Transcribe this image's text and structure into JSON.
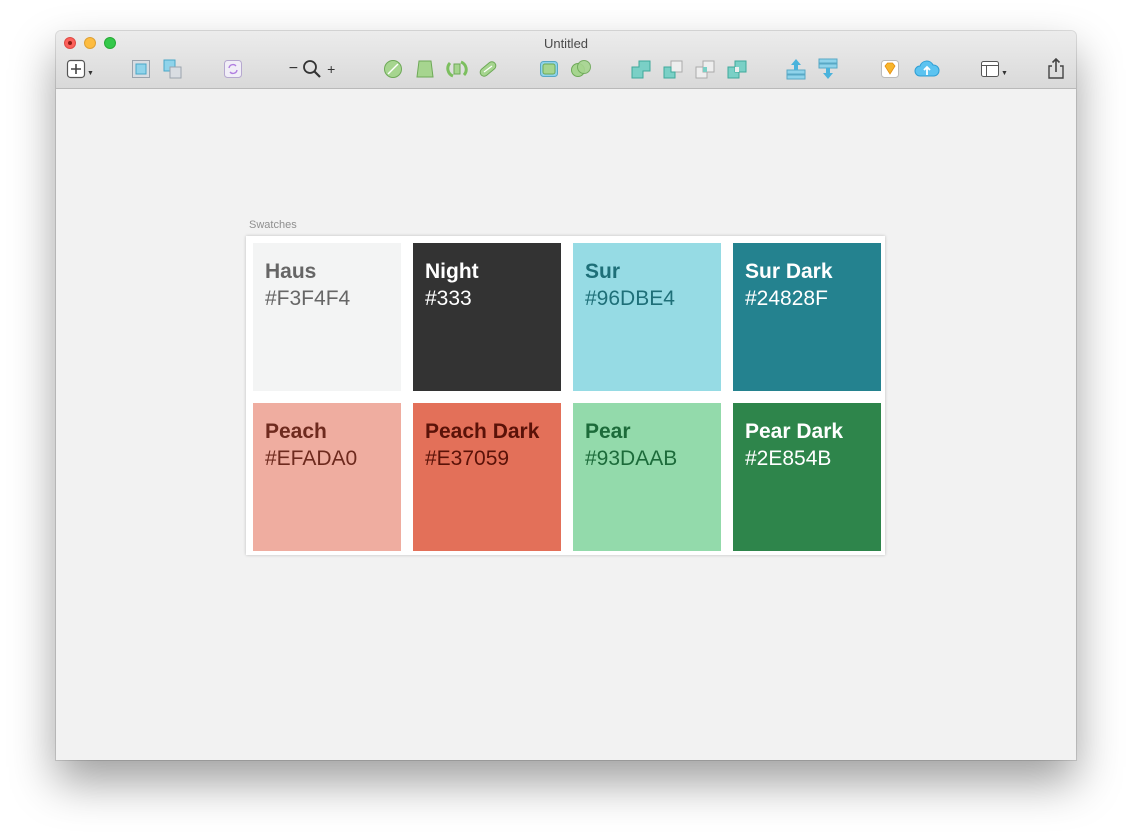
{
  "window": {
    "title": "Untitled"
  },
  "toolbar": {
    "zoom_minus": "−",
    "zoom_plus": "+",
    "items": [
      "insert-icon",
      "group-icon",
      "ungroup-icon",
      "create-symbol-icon",
      "zoom-icon",
      "edit-icon",
      "transform-icon",
      "rotate-icon",
      "flatten-icon",
      "mask-icon",
      "scale-icon",
      "union-icon",
      "subtract-icon",
      "intersect-icon",
      "difference-icon",
      "forward-icon",
      "backward-icon",
      "sketch-cloud-icon",
      "upload-cloud-icon",
      "view-icon",
      "export-icon"
    ]
  },
  "artboard": {
    "label": "Swatches",
    "swatches": [
      {
        "name": "Haus",
        "hex": "#F3F4F4",
        "bg": "#F3F4F4",
        "text": "#666666"
      },
      {
        "name": "Night",
        "hex": "#333",
        "bg": "#333333",
        "text": "#FFFFFF"
      },
      {
        "name": "Sur",
        "hex": "#96DBE4",
        "bg": "#96DBE4",
        "text": "#1E6F78"
      },
      {
        "name": "Sur Dark",
        "hex": "#24828F",
        "bg": "#24828F",
        "text": "#FFFFFF"
      },
      {
        "name": "Peach",
        "hex": "#EFADA0",
        "bg": "#EFADA0",
        "text": "#6E2A1E"
      },
      {
        "name": "Peach Dark",
        "hex": "#E37059",
        "bg": "#E37059",
        "text": "#5A1208"
      },
      {
        "name": "Pear",
        "hex": "#93DAAB",
        "bg": "#93DAAB",
        "text": "#1C6B3A"
      },
      {
        "name": "Pear Dark",
        "hex": "#2E854B",
        "bg": "#2E854B",
        "text": "#FFFFFF"
      }
    ]
  }
}
